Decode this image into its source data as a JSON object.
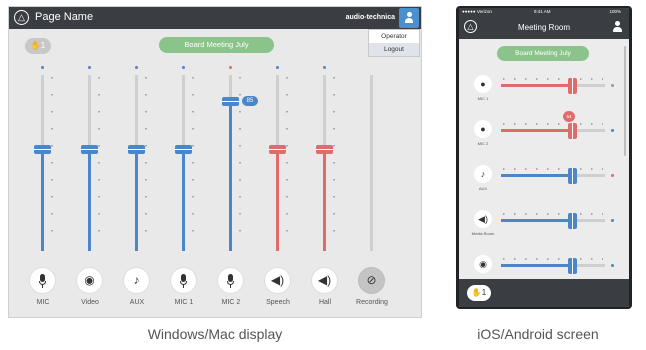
{
  "desktop": {
    "page_title": "Page Name",
    "brand": "audio-technica",
    "menu": [
      "Operator",
      "Logout"
    ],
    "badge": "1",
    "meeting": "Board Meeting July",
    "channels": [
      {
        "label": "MIC",
        "glyph": "mic",
        "level": 0.58,
        "color": "#4a86c8",
        "dot": "#4a86c8"
      },
      {
        "label": "Video",
        "glyph": "◉",
        "level": 0.58,
        "color": "#4a86c8",
        "dot": "#4a86c8"
      },
      {
        "label": "AUX",
        "glyph": "♪",
        "level": 0.58,
        "color": "#4a86c8",
        "dot": "#4a86c8"
      },
      {
        "label": "MIC 1",
        "glyph": "mic",
        "level": 0.58,
        "color": "#4a86c8",
        "dot": "#4a86c8"
      },
      {
        "label": "MIC 2",
        "glyph": "mic",
        "level": 0.85,
        "color": "#4a86c8",
        "dot": "#e06b6b",
        "value": "85"
      },
      {
        "label": "Speech",
        "glyph": "◀)",
        "level": 0.58,
        "color": "#e06b6b",
        "dot": "#4a86c8"
      },
      {
        "label": "Hall",
        "glyph": "◀)",
        "level": 0.58,
        "color": "#e06b6b",
        "dot": "#4a86c8"
      },
      {
        "label": "Recording",
        "glyph": "⊘",
        "level": 0,
        "color": "#cfcfcf",
        "dot": "transparent",
        "disabled": true
      }
    ],
    "caption": "Windows/Mac display"
  },
  "mobile": {
    "status_carrier": "●●●●● Verizon",
    "status_time": "9:41 AM",
    "status_battery": "100%",
    "title": "Meeting Room",
    "meeting": "Board Meeting July",
    "badge": "1",
    "channels": [
      {
        "label": "MIC 1",
        "glyph": "mic",
        "level": 0.68,
        "color": "#e06b6b",
        "end": "#9a9a9a"
      },
      {
        "label": "MIC 2",
        "glyph": "mic",
        "level": 0.68,
        "color": "#e06b6b",
        "end": "#4a86c8",
        "value": "64"
      },
      {
        "label": "AUX",
        "glyph": "♪",
        "level": 0.68,
        "color": "#4a86c8",
        "end": "#e06b6b"
      },
      {
        "label": "Media Room",
        "glyph": "◀)",
        "level": 0.68,
        "color": "#4a86c8",
        "end": "#4a86c8"
      },
      {
        "label": "",
        "glyph": "◉",
        "level": 0.68,
        "color": "#4a86c8",
        "end": "#4a86c8"
      }
    ],
    "caption": "iOS/Android screen"
  }
}
